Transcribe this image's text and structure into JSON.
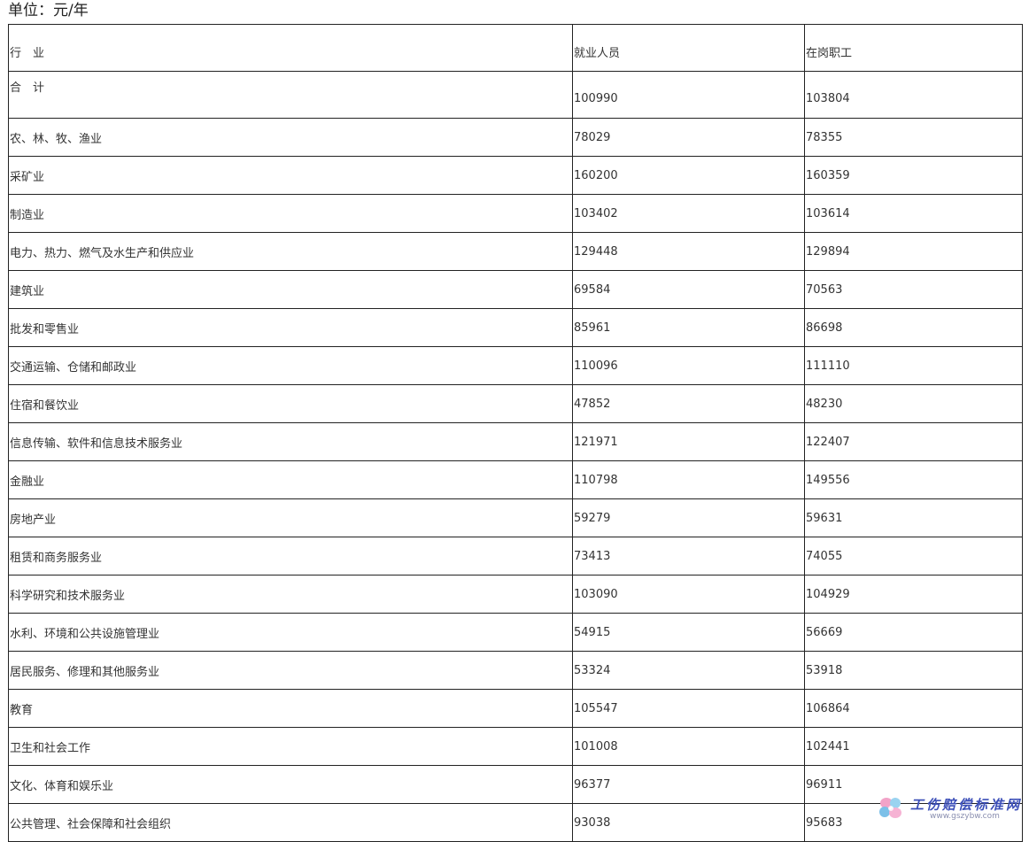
{
  "unit_label": "单位：元/年",
  "table": {
    "headers": [
      "行　业",
      "就业人员",
      "在岗职工"
    ],
    "rows": [
      {
        "industry": "合　计",
        "employed": "100990",
        "on_post": "103804"
      },
      {
        "industry": "农、林、牧、渔业",
        "employed": "78029",
        "on_post": "78355"
      },
      {
        "industry": "采矿业",
        "employed": "160200",
        "on_post": "160359"
      },
      {
        "industry": "制造业",
        "employed": "103402",
        "on_post": "103614"
      },
      {
        "industry": "电力、热力、燃气及水生产和供应业",
        "employed": "129448",
        "on_post": "129894"
      },
      {
        "industry": "建筑业",
        "employed": "69584",
        "on_post": "70563"
      },
      {
        "industry": "批发和零售业",
        "employed": "85961",
        "on_post": "86698"
      },
      {
        "industry": "交通运输、仓储和邮政业",
        "employed": "110096",
        "on_post": "111110"
      },
      {
        "industry": "住宿和餐饮业",
        "employed": "47852",
        "on_post": "48230"
      },
      {
        "industry": "信息传输、软件和信息技术服务业",
        "employed": "121971",
        "on_post": "122407"
      },
      {
        "industry": "金融业",
        "employed": "110798",
        "on_post": "149556"
      },
      {
        "industry": "房地产业",
        "employed": "59279",
        "on_post": "59631"
      },
      {
        "industry": "租赁和商务服务业",
        "employed": "73413",
        "on_post": "74055"
      },
      {
        "industry": "科学研究和技术服务业",
        "employed": "103090",
        "on_post": "104929"
      },
      {
        "industry": "水利、环境和公共设施管理业",
        "employed": "54915",
        "on_post": "56669"
      },
      {
        "industry": "居民服务、修理和其他服务业",
        "employed": "53324",
        "on_post": "53918"
      },
      {
        "industry": "教育",
        "employed": "105547",
        "on_post": "106864"
      },
      {
        "industry": "卫生和社会工作",
        "employed": "101008",
        "on_post": "102441"
      },
      {
        "industry": "文化、体育和娱乐业",
        "employed": "96377",
        "on_post": "96911"
      },
      {
        "industry": "公共管理、社会保障和社会组织",
        "employed": "93038",
        "on_post": "95683"
      }
    ]
  },
  "watermark": {
    "text": "工伤赔偿标准网",
    "url": "www.gszybw.com"
  }
}
